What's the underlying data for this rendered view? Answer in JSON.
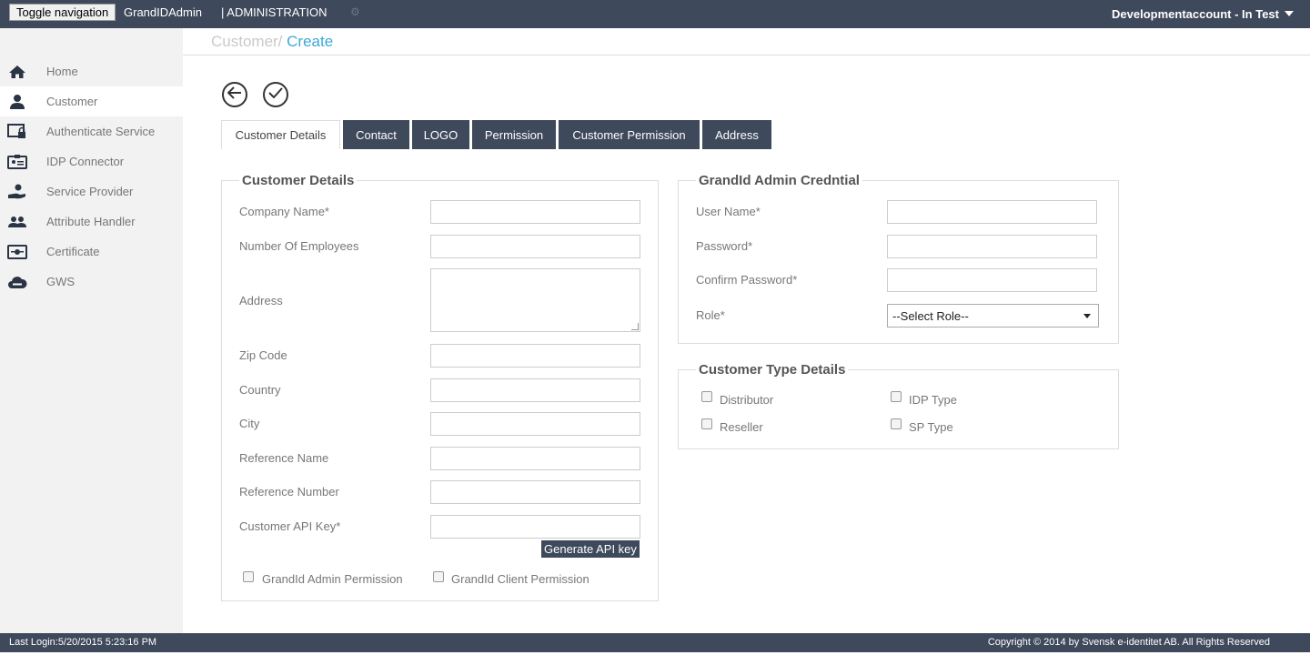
{
  "header": {
    "toggle_label": "Toggle navigation",
    "brand": "GrandIDAdmin",
    "section": "| ADMINISTRATION",
    "account": "Developmentaccount - In Test"
  },
  "sidebar": {
    "items": [
      {
        "label": "Home",
        "icon": "home-icon"
      },
      {
        "label": "Customer",
        "icon": "user-icon"
      },
      {
        "label": "Authenticate Service",
        "icon": "lock-screen-icon"
      },
      {
        "label": "IDP Connector",
        "icon": "id-card-icon"
      },
      {
        "label": "Service Provider",
        "icon": "hand-user-icon"
      },
      {
        "label": "Attribute Handler",
        "icon": "users-icon"
      },
      {
        "label": "Certificate",
        "icon": "certificate-icon"
      },
      {
        "label": "GWS",
        "icon": "cloud-icon"
      }
    ],
    "active_index": 1
  },
  "breadcrumb": {
    "parent": "Customer/",
    "current": " Create"
  },
  "tabs": [
    {
      "label": "Customer Details",
      "active": true
    },
    {
      "label": "Contact",
      "active": false
    },
    {
      "label": "LOGO",
      "active": false
    },
    {
      "label": "Permission",
      "active": false
    },
    {
      "label": "Customer Permission",
      "active": false
    },
    {
      "label": "Address",
      "active": false
    }
  ],
  "customer_details": {
    "legend": "Customer Details",
    "fields": {
      "company_name": "Company Name*",
      "employees": "Number Of Employees",
      "address": "Address",
      "zip": "Zip Code",
      "country": "Country",
      "city": "City",
      "reference_name": "Reference Name",
      "reference_number": "Reference Number",
      "api_key": "Customer API Key*"
    },
    "generate_label": "Generate API key",
    "perm_admin": "GrandId Admin Permission",
    "perm_client": "GrandId Client Permission"
  },
  "admin_credential": {
    "legend": "GrandId Admin Credntial",
    "user_name": "User Name*",
    "password": "Password*",
    "confirm_password": "Confirm Password*",
    "role": "Role*",
    "role_selected": "--Select Role--"
  },
  "customer_type": {
    "legend": "Customer Type Details",
    "distributor": "Distributor",
    "idp_type": "IDP Type",
    "reseller": "Reseller",
    "sp_type": "SP Type"
  },
  "footer": {
    "last_login": "Last Login:5/20/2015 5:23:16 PM",
    "copyright": "Copyright © 2014 by Svensk e-identitet AB. All Rights Reserved"
  }
}
